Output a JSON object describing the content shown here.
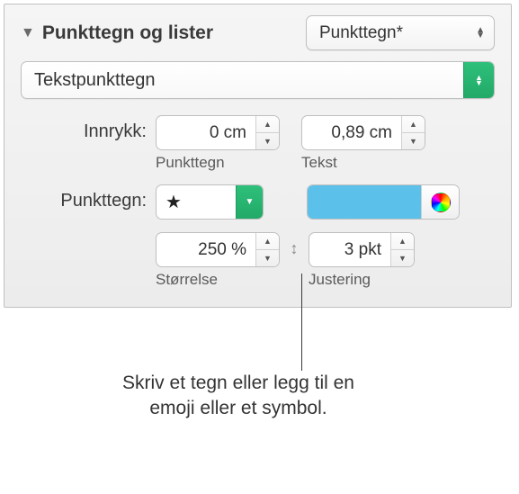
{
  "header": {
    "title": "Punkttegn og lister",
    "style_preset": "Punkttegn*"
  },
  "bullet_type": "Tekstpunkttegn",
  "indent": {
    "label": "Innrykk:",
    "bullet_value": "0 cm",
    "bullet_sublabel": "Punkttegn",
    "text_value": "0,89 cm",
    "text_sublabel": "Tekst"
  },
  "bullet": {
    "label": "Punkttegn:",
    "symbol": "★",
    "color": "#5bc1eb"
  },
  "size": {
    "value": "250 %",
    "sublabel": "Størrelse"
  },
  "alignment": {
    "value": "3 pkt",
    "sublabel": "Justering"
  },
  "callout": "Skriv et tegn eller legg til en emoji eller et symbol."
}
